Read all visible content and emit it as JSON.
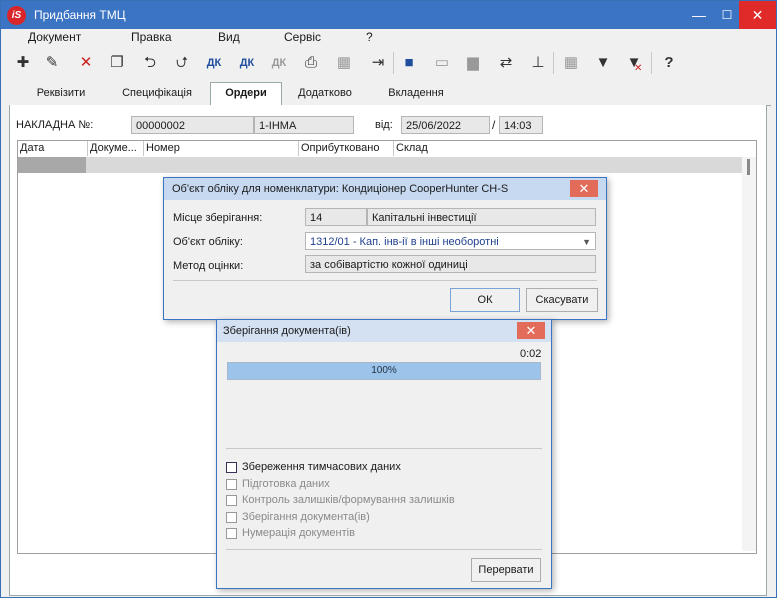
{
  "window": {
    "title": "Придбання ТМЦ",
    "logo": "iS",
    "minimize": "—",
    "maximize": "☐",
    "close": "✕"
  },
  "menu": [
    "Документ",
    "Правка",
    "Вид",
    "Сервіс",
    "?"
  ],
  "toolbar": {
    "icons": [
      "new-icon",
      "edit-icon",
      "delete-icon",
      "copy-icon",
      "import-icon",
      "export-icon",
      "dk-icon",
      "dk-red-icon",
      "dk-gray-icon",
      "print-icon",
      "excel-icon",
      "exit-icon",
      "save-icon",
      "book-icon",
      "folder-icon",
      "transfer-icon",
      "tree-icon",
      "table-icon",
      "filter-icon",
      "clear-filter-icon",
      "help-icon"
    ],
    "dk": "ДК"
  },
  "tabs": [
    "Реквізити",
    "Специфікація",
    "Ордери",
    "Додатково",
    "Вкладення"
  ],
  "active_tab": "Ордери",
  "header": {
    "invoice_label": "НАКЛАДНА №:",
    "invoice_number": "00000002",
    "invoice_code": "1-ІНМА",
    "from_label": "від:",
    "date": "25/06/2022",
    "date_sep": "/",
    "time": "14:03"
  },
  "grid": {
    "columns": [
      "Дата",
      "Докуме...",
      "Номер",
      "Оприбутковано",
      "Склад"
    ]
  },
  "dialog_accounting": {
    "title": "Об'єкт обліку для номенклатури: Кондиціонер CooperHunter CH-S",
    "close": "✕",
    "storage_label": "Місце зберігання:",
    "storage_code": "14",
    "storage_name": "Капітальні інвестиції",
    "object_label": "Об'єкт обліку:",
    "object_value": "1312/01 - Кап. інв-ії в інші необоротні",
    "method_label": "Метод оцінки:",
    "method_value": "за собівартістю кожної одиниці",
    "ok": "ОК",
    "cancel": "Скасувати"
  },
  "dialog_saving": {
    "title": "Зберігання документа(ів)",
    "close": "✕",
    "elapsed": "0:02",
    "progress_text": "100%",
    "progress": 1.0,
    "steps": [
      {
        "label": "Збереження тимчасових даних",
        "active": true
      },
      {
        "label": "Підготовка даних",
        "active": false
      },
      {
        "label": "Контроль залишків/формування залишків",
        "active": false
      },
      {
        "label": "Зберігання документа(ів)",
        "active": false
      },
      {
        "label": "Нумерація документів",
        "active": false
      }
    ],
    "abort": "Перервати"
  }
}
